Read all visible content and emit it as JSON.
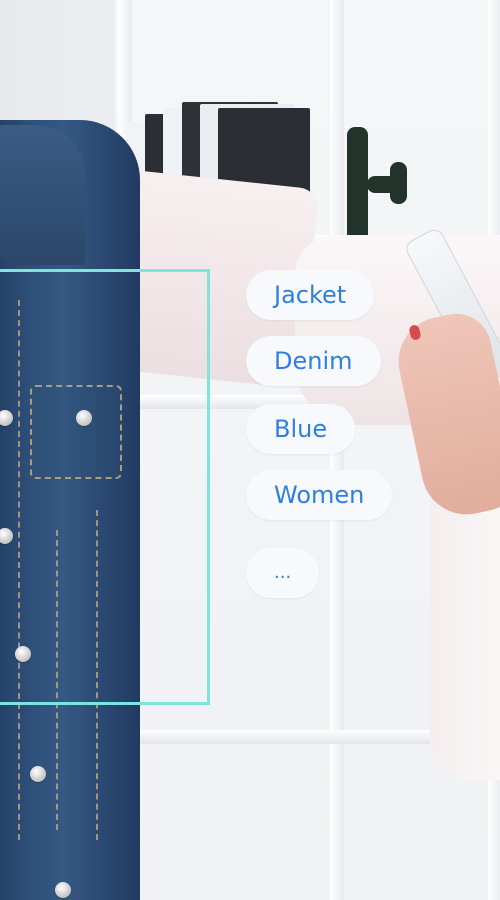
{
  "tags": [
    {
      "label": "Jacket"
    },
    {
      "label": "Denim"
    },
    {
      "label": "Blue"
    },
    {
      "label": "Women"
    },
    {
      "label": "..."
    }
  ],
  "colors": {
    "focus_box": "#7ce5dc",
    "chip_background": "#f7f9fc",
    "chip_text": "#2f7fe3"
  }
}
